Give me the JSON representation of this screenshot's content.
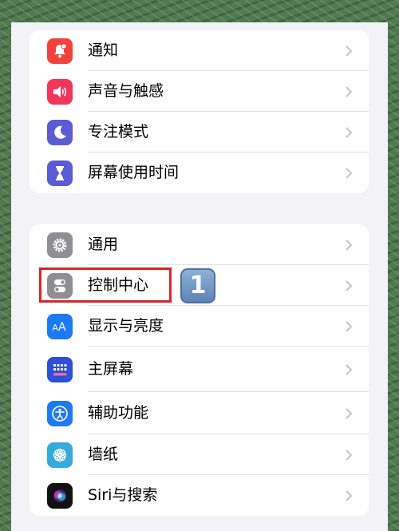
{
  "groups": [
    {
      "items": [
        {
          "label": "通知",
          "icon": "notifications-icon",
          "color": "#f2423b"
        },
        {
          "label": "声音与触感",
          "icon": "sound-icon",
          "color": "#f2375c"
        },
        {
          "label": "专注模式",
          "icon": "moon-icon",
          "color": "#5b5bd6"
        },
        {
          "label": "屏幕使用时间",
          "icon": "hourglass-icon",
          "color": "#5b5bd6"
        }
      ]
    },
    {
      "items": [
        {
          "label": "通用",
          "icon": "gear-icon",
          "color": "#8e8e93"
        },
        {
          "label": "控制中心",
          "icon": "toggles-icon",
          "color": "#8e8e93"
        },
        {
          "label": "显示与亮度",
          "icon": "text-size-icon",
          "color": "#1c7af5"
        },
        {
          "label": "主屏幕",
          "icon": "home-grid-icon",
          "color": "#2f4fd8"
        },
        {
          "label": "辅助功能",
          "icon": "accessibility-icon",
          "color": "#1f7bf2"
        },
        {
          "label": "墙纸",
          "icon": "flower-icon",
          "color": "#35aadc"
        },
        {
          "label": "Siri与搜索",
          "icon": "siri-icon",
          "color": "#111111"
        }
      ]
    }
  ],
  "annotation": {
    "step_number": "1",
    "highlight_color": "#d6262b"
  }
}
